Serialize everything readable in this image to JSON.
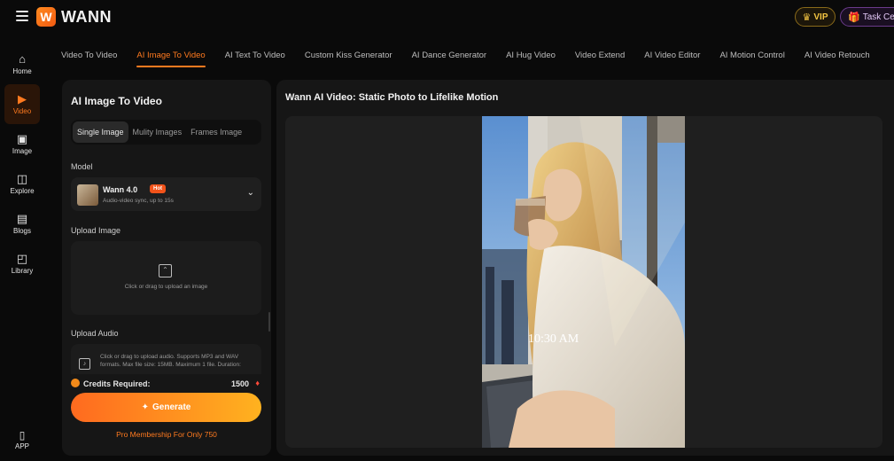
{
  "brand": {
    "name": "WANN",
    "logo_letter": "W"
  },
  "header": {
    "vip_label": "VIP",
    "task_label": "Task Center"
  },
  "nav": {
    "items": [
      {
        "label": "Home",
        "icon": "home-icon"
      },
      {
        "label": "Video",
        "icon": "video-icon",
        "active": true
      },
      {
        "label": "Image",
        "icon": "image-icon"
      },
      {
        "label": "Explore",
        "icon": "explore-icon"
      },
      {
        "label": "Blogs",
        "icon": "blogs-icon"
      },
      {
        "label": "Library",
        "icon": "library-icon"
      }
    ],
    "app_label": "APP"
  },
  "tabs": [
    {
      "label": "Video To Video"
    },
    {
      "label": "AI Image To Video",
      "active": true
    },
    {
      "label": "AI Text To Video"
    },
    {
      "label": "Custom Kiss Generator"
    },
    {
      "label": "AI Dance Generator"
    },
    {
      "label": "AI Hug Video"
    },
    {
      "label": "Video Extend"
    },
    {
      "label": "AI Video Editor"
    },
    {
      "label": "AI Motion Control"
    },
    {
      "label": "AI Video Retouch"
    }
  ],
  "panel": {
    "title": "AI Image To Video",
    "modes": [
      {
        "label": "Single Image",
        "active": true
      },
      {
        "label": "Mulity Images"
      },
      {
        "label": "Frames Image"
      }
    ],
    "model_label": "Model",
    "model_name": "Wann 4.0",
    "model_badge": "Hot",
    "model_desc": "Audio-video sync, up to 15s",
    "upload_image_label": "Upload Image",
    "upload_image_hint": "Click or drag to upload an image",
    "upload_audio_label": "Upload Audio",
    "upload_audio_hint": "Click or drag to upload audio. Supports MP3 and WAV formats. Max file size: 15MB. Maximum 1 file. Duration:",
    "credits_label": "Credits Required:",
    "credits_value": "1500",
    "generate_label": "Generate",
    "promo": "Pro Membership For Only 750"
  },
  "preview": {
    "title": "Wann AI Video: Static Photo to Lifelike Motion",
    "overlay_time": "10:30 AM"
  },
  "colors": {
    "accent": "#ff7a1f",
    "gold": "#f4c542",
    "bg": "#0a0a0a",
    "panel": "#161616"
  }
}
